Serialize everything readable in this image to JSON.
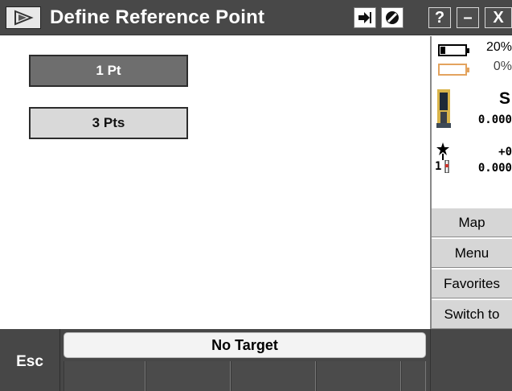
{
  "title_bar": {
    "title": "Define Reference Point",
    "icons": [
      "app-icon",
      "enter-icon",
      "no-icon"
    ],
    "help_label": "?",
    "minimize_label": "–",
    "close_label": "X"
  },
  "main": {
    "buttons": [
      {
        "label": "1 Pt",
        "state": "selected"
      },
      {
        "label": "3 Pts",
        "state": "normal"
      }
    ]
  },
  "side_panel": {
    "battery_1": {
      "percent_label": "20%",
      "level": 0.2
    },
    "battery_2": {
      "percent_label": "0%",
      "level": 0
    },
    "instrument_status": "S",
    "instrument_value": "0.000",
    "target_offset": "+0",
    "target_height": "0.000",
    "target_number": "1",
    "buttons": [
      {
        "label": "Map"
      },
      {
        "label": "Menu"
      },
      {
        "label": "Favorites"
      },
      {
        "label": "Switch to"
      }
    ]
  },
  "bottom_bar": {
    "esc_label": "Esc",
    "target_status": "No Target"
  },
  "colors": {
    "title_bar": "#484848",
    "selected_button": "#6e6e6e",
    "normal_button": "#d9d9d9",
    "battery_warning": "#e3a35e",
    "side_button": "#d6d6d6"
  }
}
